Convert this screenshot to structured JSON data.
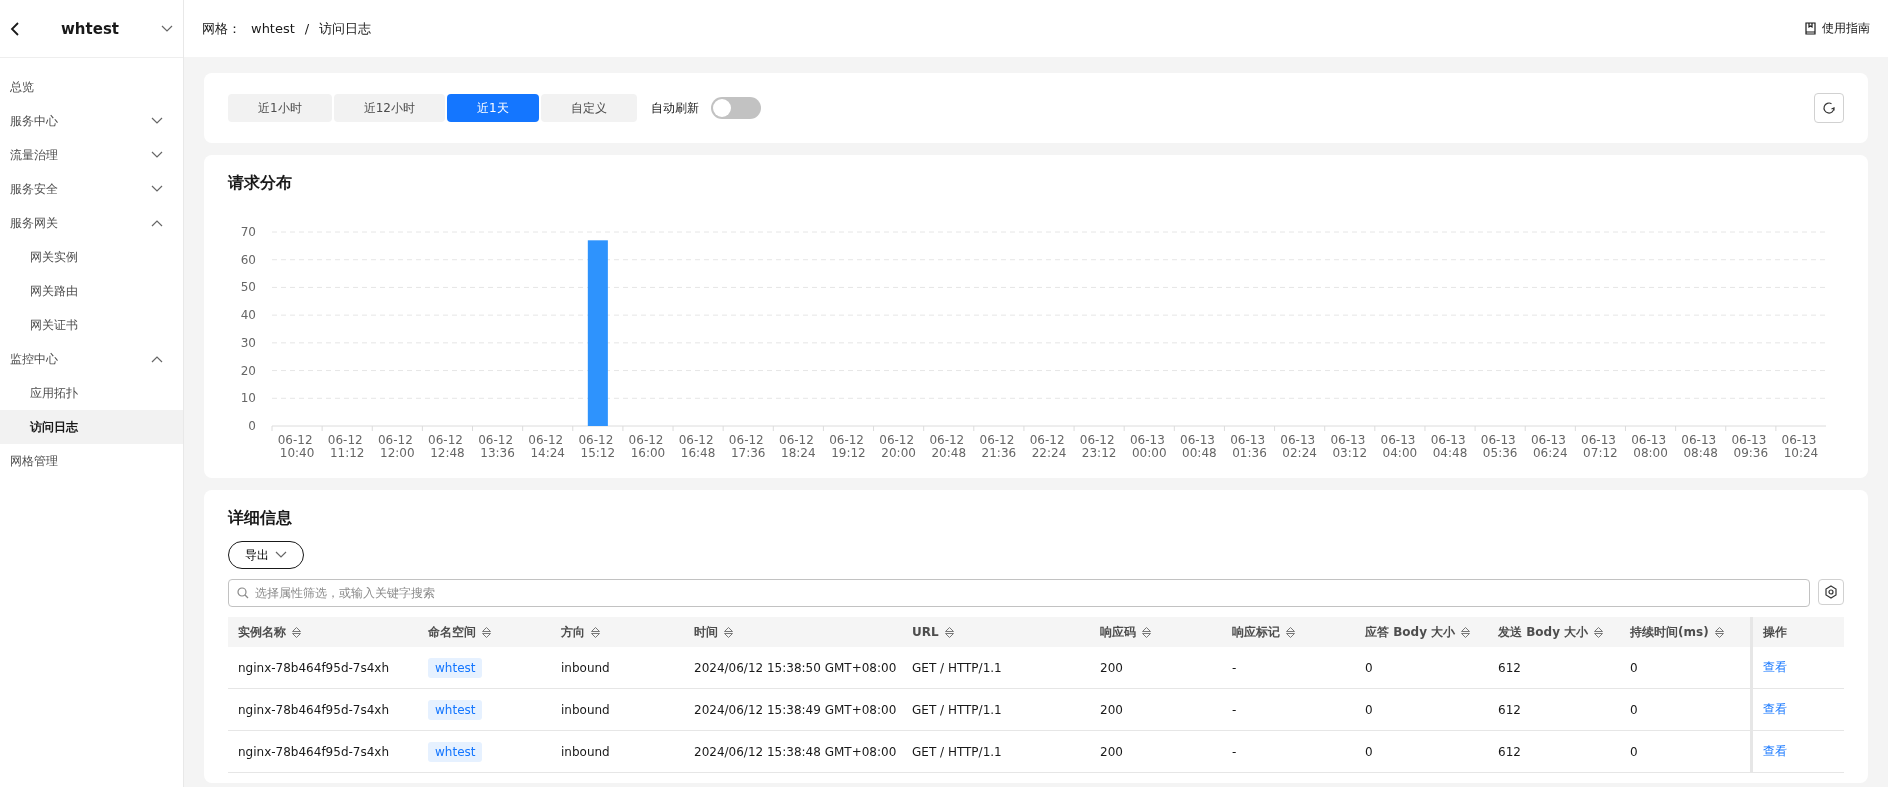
{
  "sidebar": {
    "title": "whtest",
    "items": [
      {
        "label": "总览",
        "selected": false
      },
      {
        "label": "服务中心",
        "selected": false,
        "expanded": false
      },
      {
        "label": "流量治理",
        "selected": false,
        "expanded": false
      },
      {
        "label": "服务安全",
        "selected": false,
        "expanded": false
      },
      {
        "label": "服务网关",
        "selected": false,
        "expanded": true,
        "children": [
          {
            "label": "网关实例",
            "selected": false
          },
          {
            "label": "网关路由",
            "selected": false
          },
          {
            "label": "网关证书",
            "selected": false
          }
        ]
      },
      {
        "label": "监控中心",
        "selected": false,
        "expanded": true,
        "children": [
          {
            "label": "应用拓扑",
            "selected": false
          },
          {
            "label": "访问日志",
            "selected": true
          }
        ]
      },
      {
        "label": "网格管理",
        "selected": false
      }
    ]
  },
  "breadcrumb": {
    "prefix": "网格：",
    "mesh": "whtest",
    "separator": "/",
    "page": "访问日志"
  },
  "guide_link": "使用指南",
  "time_ranges": [
    {
      "label": "近1小时",
      "selected": false
    },
    {
      "label": "近12小时",
      "selected": false
    },
    {
      "label": "近1天",
      "selected": true
    },
    {
      "label": "自定义",
      "selected": false
    }
  ],
  "auto_refresh": {
    "label": "自动刷新",
    "on": false
  },
  "chart_section": {
    "title": "请求分布",
    "chart_data": {
      "type": "bar",
      "categories": [
        "06-12 10:40",
        "06-12 11:12",
        "06-12 12:00",
        "06-12 12:48",
        "06-12 13:36",
        "06-12 14:24",
        "06-12 15:12",
        "06-12 16:00",
        "06-12 16:48",
        "06-12 17:36",
        "06-12 18:24",
        "06-12 19:12",
        "06-12 20:00",
        "06-12 20:48",
        "06-12 21:36",
        "06-12 22:24",
        "06-12 23:12",
        "06-13 00:00",
        "06-13 00:48",
        "06-13 01:36",
        "06-13 02:24",
        "06-13 03:12",
        "06-13 04:00",
        "06-13 04:48",
        "06-13 05:36",
        "06-13 06:24",
        "06-13 07:12",
        "06-13 08:00",
        "06-13 08:48",
        "06-13 09:36",
        "06-13 10:24"
      ],
      "series": [
        {
          "color": "#2e93fd",
          "values": [
            0,
            0,
            0,
            0,
            0,
            0,
            67,
            0,
            0,
            0,
            0,
            0,
            0,
            0,
            0,
            0,
            0,
            0,
            0,
            0,
            0,
            0,
            0,
            0,
            0,
            0,
            0,
            0,
            0,
            0,
            0
          ]
        }
      ],
      "grid": true,
      "ylim": [
        0,
        70
      ],
      "yticks": [
        0,
        10,
        20,
        30,
        40,
        50,
        60,
        70
      ]
    }
  },
  "details": {
    "title": "详细信息",
    "export_label": "导出",
    "search": {
      "placeholder": "选择属性筛选，或输入关键字搜索"
    },
    "columns": [
      {
        "label": "实例名称",
        "sortable": true
      },
      {
        "label": "命名空间",
        "sortable": true
      },
      {
        "label": "方向",
        "sortable": true
      },
      {
        "label": "时间",
        "sortable": true
      },
      {
        "label": "URL",
        "sortable": true
      },
      {
        "label": "响应码",
        "sortable": true
      },
      {
        "label": "响应标记",
        "sortable": true
      },
      {
        "label": "应答 Body 大小",
        "sortable": true
      },
      {
        "label": "发送 Body 大小",
        "sortable": true
      },
      {
        "label": "持续时间(ms)",
        "sortable": true
      },
      {
        "label": "操作",
        "sortable": false
      }
    ],
    "rows": [
      {
        "instance": "nginx-78b464f95d-7s4xh",
        "namespace": "whtest",
        "direction": "inbound",
        "time": "2024/06/12 15:38:50 GMT+08:00",
        "url": "GET / HTTP/1.1",
        "code": "200",
        "flag": "-",
        "resp_body": "0",
        "sent_body": "612",
        "duration": "0",
        "action": "查看"
      },
      {
        "instance": "nginx-78b464f95d-7s4xh",
        "namespace": "whtest",
        "direction": "inbound",
        "time": "2024/06/12 15:38:49 GMT+08:00",
        "url": "GET / HTTP/1.1",
        "code": "200",
        "flag": "-",
        "resp_body": "0",
        "sent_body": "612",
        "duration": "0",
        "action": "查看"
      },
      {
        "instance": "nginx-78b464f95d-7s4xh",
        "namespace": "whtest",
        "direction": "inbound",
        "time": "2024/06/12 15:38:48 GMT+08:00",
        "url": "GET / HTTP/1.1",
        "code": "200",
        "flag": "-",
        "resp_body": "0",
        "sent_body": "612",
        "duration": "0",
        "action": "查看"
      }
    ]
  }
}
